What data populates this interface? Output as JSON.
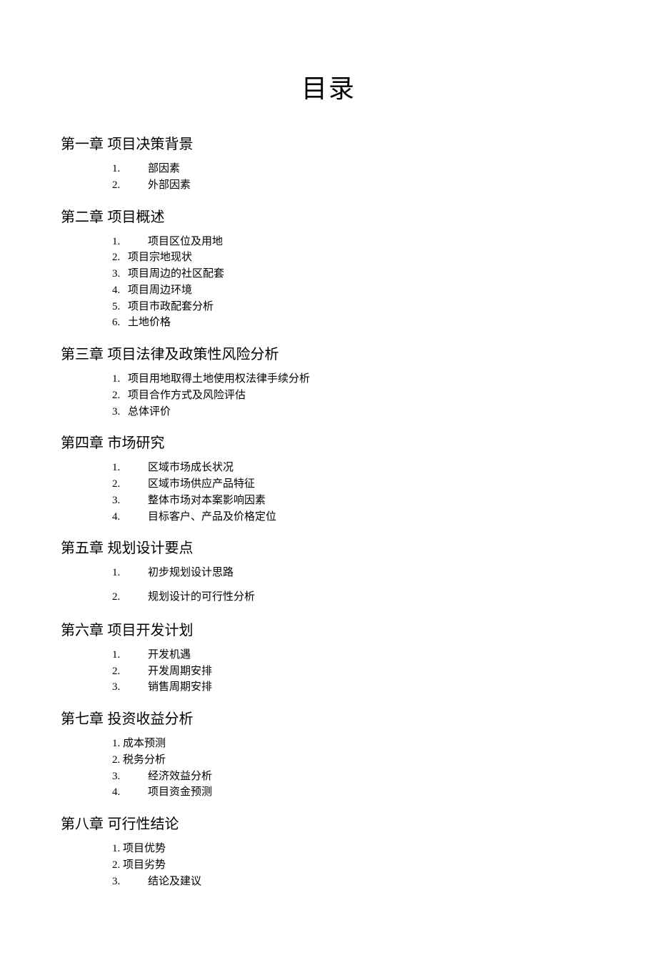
{
  "title": "目录",
  "chapters": [
    {
      "label": "第一章  项目决策背景",
      "items": [
        {
          "n": "1.",
          "t": "部因素",
          "style": "wide"
        },
        {
          "n": "2.",
          "t": "外部因素",
          "style": "wide"
        }
      ]
    },
    {
      "label": "第二章  项目概述",
      "items": [
        {
          "n": "1.",
          "t": "项目区位及用地",
          "style": "wide"
        },
        {
          "n": "2.",
          "t": "项目宗地现状",
          "style": "tight"
        },
        {
          "n": "3.",
          "t": "项目周边的社区配套",
          "style": "tight"
        },
        {
          "n": "4.",
          "t": "项目周边环境",
          "style": "tight"
        },
        {
          "n": "5.",
          "t": "项目市政配套分析",
          "style": "tight"
        },
        {
          "n": "6.",
          "t": "土地价格",
          "style": "tight"
        }
      ]
    },
    {
      "label": "第三章  项目法律及政策性风险分析",
      "items": [
        {
          "n": "1.",
          "t": "项目用地取得土地使用权法律手续分析",
          "style": "tight"
        },
        {
          "n": "2.",
          "t": "项目合作方式及风险评估",
          "style": "tight"
        },
        {
          "n": "3.",
          "t": "总体评价",
          "style": "tight"
        }
      ]
    },
    {
      "label": "第四章  市场研究",
      "items": [
        {
          "n": "1.",
          "t": "区域市场成长状况",
          "style": "wide"
        },
        {
          "n": "2.",
          "t": "区域市场供应产品特征",
          "style": "wide"
        },
        {
          "n": "3.",
          "t": "整体市场对本案影响因素",
          "style": "wide"
        },
        {
          "n": "4.",
          "t": "目标客户、产品及价格定位",
          "style": "wide"
        }
      ]
    },
    {
      "label": "第五章  规划设计要点",
      "items": [
        {
          "n": "1.",
          "t": "初步规划设计思路",
          "style": "wide"
        },
        {
          "n": "2.",
          "t": "规划设计的可行性分析",
          "style": "wide"
        }
      ]
    },
    {
      "label": "第六章  项目开发计划",
      "items": [
        {
          "n": "1.",
          "t": "开发机遇",
          "style": "wide"
        },
        {
          "n": "2.",
          "t": "开发周期安排",
          "style": "wide"
        },
        {
          "n": "3.",
          "t": "销售周期安排",
          "style": "wide"
        }
      ]
    },
    {
      "label": "第七章  投资收益分析",
      "items": [
        {
          "n": "1.",
          "t": "成本预测",
          "style": "vtight"
        },
        {
          "n": "2.",
          "t": "税务分析",
          "style": "vtight"
        },
        {
          "n": "3.",
          "t": "经济效益分析",
          "style": "wide"
        },
        {
          "n": "4.",
          "t": "项目资金预测",
          "style": "wide"
        }
      ]
    },
    {
      "label": "第八章  可行性结论",
      "items": [
        {
          "n": "1.",
          "t": "项目优势",
          "style": "vtight"
        },
        {
          "n": "2.",
          "t": "项目劣势",
          "style": "vtight"
        },
        {
          "n": "3.",
          "t": "结论及建议",
          "style": "wide"
        }
      ]
    }
  ]
}
